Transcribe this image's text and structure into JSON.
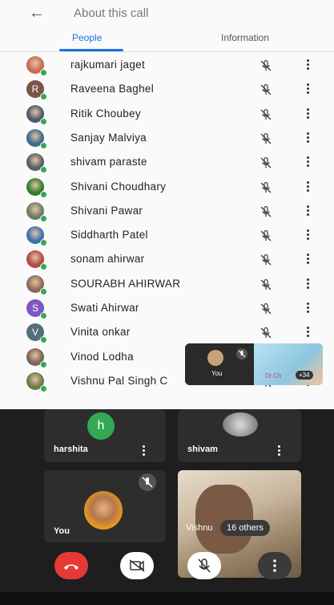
{
  "header": {
    "back_icon": "arrow-back-icon",
    "title": "About this call"
  },
  "tabs": [
    {
      "label": "People",
      "active": true
    },
    {
      "label": "Information",
      "active": false
    }
  ],
  "participants": [
    {
      "name": "rajkumari jaget",
      "avatar": "photo",
      "color": "#c86a54"
    },
    {
      "name": "Raveena Baghel",
      "avatar": "letter",
      "letter": "R",
      "color": "#795548"
    },
    {
      "name": "Ritik Choubey",
      "avatar": "photo",
      "color": "#4a5a6a"
    },
    {
      "name": "Sanjay Malviya",
      "avatar": "photo",
      "color": "#3d6b8a"
    },
    {
      "name": "shivam paraste",
      "avatar": "photo",
      "color": "#555f66"
    },
    {
      "name": "Shivani Choudhary",
      "avatar": "photo",
      "color": "#2e7d32"
    },
    {
      "name": "Shivani Pawar",
      "avatar": "photo",
      "color": "#6d7b6a"
    },
    {
      "name": "Siddharth Patel",
      "avatar": "photo",
      "color": "#3a6fb0"
    },
    {
      "name": "sonam ahirwar",
      "avatar": "photo",
      "color": "#b04a4a"
    },
    {
      "name": "SOURABH AHIRWAR",
      "avatar": "photo",
      "color": "#8a6a5a"
    },
    {
      "name": "Swati Ahirwar",
      "avatar": "letter",
      "letter": "S",
      "color": "#7e57c2"
    },
    {
      "name": "Vinita onkar",
      "avatar": "letter",
      "letter": "V",
      "color": "#546e7a"
    },
    {
      "name": "Vinod Lodha",
      "avatar": "photo",
      "color": "#7a6454"
    },
    {
      "name": "Vishnu Pal Singh C",
      "avatar": "photo",
      "color": "#6a7a4a"
    }
  ],
  "pip": {
    "self_label": "You",
    "share_text": "Dr.Ch",
    "count": "+34"
  },
  "grid": {
    "tiles": [
      {
        "name": "harshita",
        "letter": "h"
      },
      {
        "name": "shivam"
      },
      {
        "name": "You"
      },
      {
        "name": "Vishnu"
      }
    ],
    "others_label": "16 others"
  },
  "colors": {
    "accent": "#1a73e8",
    "online": "#34a853",
    "hangup": "#e53935"
  },
  "icons": {
    "row_mic": "mic-off-icon",
    "row_more": "more-vert-icon",
    "hangup": "call-end-icon",
    "camera": "videocam-off-icon",
    "mic": "mic-off-icon",
    "more": "more-vert-icon"
  }
}
